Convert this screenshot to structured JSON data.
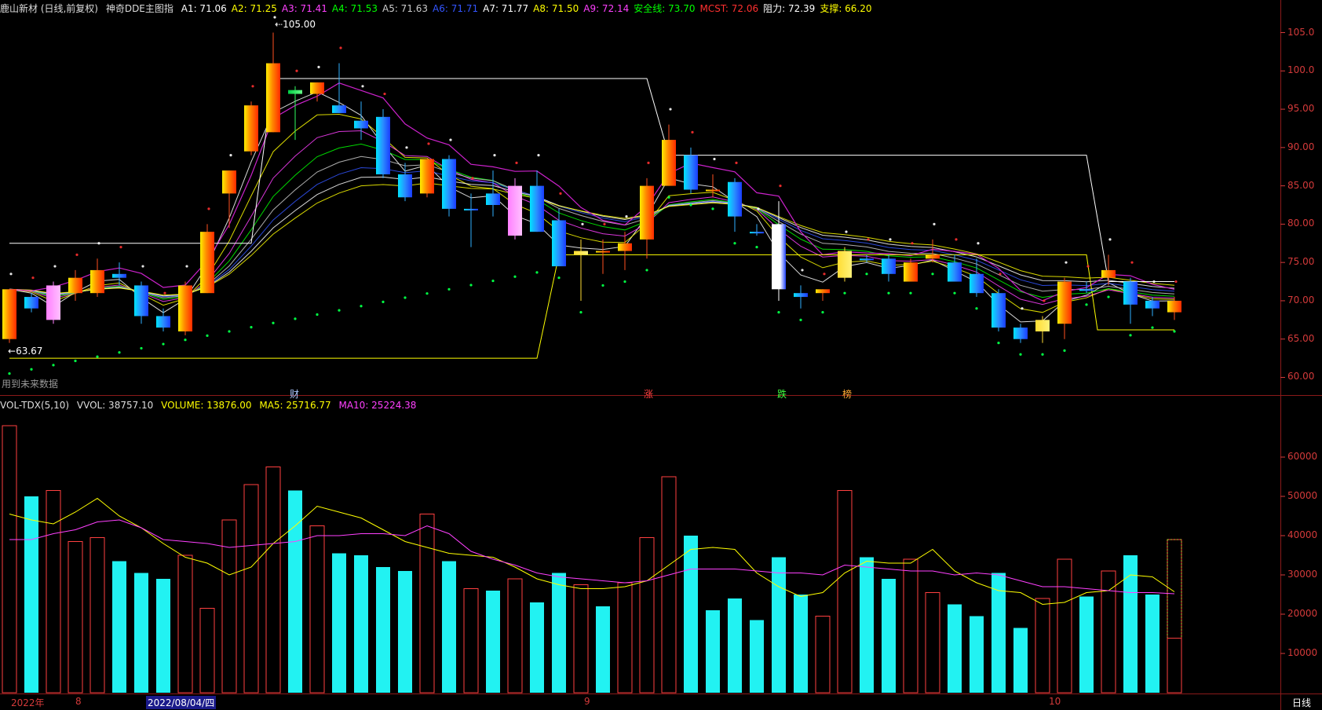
{
  "header": {
    "title": "鹿山新材 (日线,前复权)",
    "indicator": "神奇DDE主图指",
    "params": [
      {
        "label": "A1: 71.06",
        "color": "#ffffff"
      },
      {
        "label": "A2: 71.25",
        "color": "#ffff00"
      },
      {
        "label": "A3: 71.41",
        "color": "#ff40ff"
      },
      {
        "label": "A4: 71.53",
        "color": "#00ff00"
      },
      {
        "label": "A5: 71.63",
        "color": "#cccccc"
      },
      {
        "label": "A6: 71.71",
        "color": "#3355ff"
      },
      {
        "label": "A7: 71.77",
        "color": "#ffffff"
      },
      {
        "label": "A8: 71.50",
        "color": "#ffff00"
      },
      {
        "label": "A9: 72.14",
        "color": "#ff40ff"
      },
      {
        "label": "安全线: 73.70",
        "color": "#00ff00"
      },
      {
        "label": "MCST: 72.06",
        "color": "#ff3030"
      },
      {
        "label": "阻力: 72.39",
        "color": "#ffffff"
      },
      {
        "label": "支撑: 66.20",
        "color": "#ffff00"
      }
    ]
  },
  "volume_header": {
    "title": "VOL-TDX(5,10)",
    "vvol": "VVOL: 38757.10",
    "volume": "VOLUME: 13876.00",
    "ma5": "MA5: 25716.77",
    "ma10": "MA10: 25224.38"
  },
  "annotations": {
    "high": "105.00",
    "low": "63.67",
    "bottom_note": "用到未来数据",
    "events": [
      "财",
      "涨",
      "跌",
      "榜"
    ],
    "period": "日线"
  },
  "x_labels": [
    "2022年",
    "8",
    "2022/08/04/四",
    "9",
    "10"
  ],
  "colors": {
    "up": "#ff3030",
    "down": "#00e5ff",
    "axis": "#d43a3a",
    "grid": "#8b1a1a"
  },
  "chart_data": [
    {
      "type": "candlestick",
      "title": "",
      "ylim": [
        58,
        107
      ],
      "y_ticks": [
        60,
        65,
        70,
        75,
        80,
        85,
        90,
        95,
        100,
        105
      ],
      "y_tick_labels": [
        "60.00",
        "65.00",
        "70.00",
        "75.00",
        "80.00",
        "85.00",
        "90.00",
        "95.00",
        "100.0",
        "105.0"
      ],
      "candles": [
        {
          "o": 65,
          "h": 71.5,
          "l": 64.5,
          "c": 71.5,
          "col": "fire"
        },
        {
          "o": 69,
          "h": 71,
          "l": 68.5,
          "c": 70.5,
          "col": "blue"
        },
        {
          "o": 72,
          "h": 72.5,
          "l": 67,
          "c": 67.5,
          "col": "pink"
        },
        {
          "o": 71,
          "h": 74,
          "l": 70,
          "c": 73,
          "col": "fire"
        },
        {
          "o": 71,
          "h": 75.5,
          "l": 70.5,
          "c": 74,
          "col": "fire"
        },
        {
          "o": 73.5,
          "h": 75,
          "l": 72,
          "c": 73,
          "col": "blue"
        },
        {
          "o": 72,
          "h": 72.5,
          "l": 67,
          "c": 68,
          "col": "blue"
        },
        {
          "o": 68,
          "h": 69,
          "l": 66,
          "c": 66.5,
          "col": "blue"
        },
        {
          "o": 66,
          "h": 72.5,
          "l": 65.5,
          "c": 72,
          "col": "fire"
        },
        {
          "o": 71,
          "h": 80,
          "l": 71,
          "c": 79,
          "col": "fire"
        },
        {
          "o": 84,
          "h": 87,
          "l": 79.5,
          "c": 87,
          "col": "fire"
        },
        {
          "o": 89.5,
          "h": 96,
          "l": 89,
          "c": 95.5,
          "col": "fire"
        },
        {
          "o": 92,
          "h": 105,
          "l": 92,
          "c": 101,
          "col": "fire"
        },
        {
          "o": 97,
          "h": 98,
          "l": 91,
          "c": 97.5,
          "col": "green"
        },
        {
          "o": 97,
          "h": 98.5,
          "l": 96,
          "c": 98.5,
          "col": "fire"
        },
        {
          "o": 95.5,
          "h": 101,
          "l": 94.5,
          "c": 94.5,
          "col": "blue"
        },
        {
          "o": 93.5,
          "h": 96,
          "l": 91,
          "c": 92.5,
          "col": "blue"
        },
        {
          "o": 94,
          "h": 95,
          "l": 86,
          "c": 86.5,
          "col": "blue"
        },
        {
          "o": 86.5,
          "h": 88,
          "l": 83,
          "c": 83.5,
          "col": "blue"
        },
        {
          "o": 84,
          "h": 88.5,
          "l": 83.5,
          "c": 88.5,
          "col": "fire"
        },
        {
          "o": 88.5,
          "h": 89,
          "l": 81,
          "c": 82,
          "col": "blue"
        },
        {
          "o": 82,
          "h": 84,
          "l": 77,
          "c": 82,
          "col": "blue"
        },
        {
          "o": 82.5,
          "h": 87,
          "l": 81,
          "c": 84,
          "col": "blue"
        },
        {
          "o": 85,
          "h": 86,
          "l": 78,
          "c": 78.5,
          "col": "pink"
        },
        {
          "o": 85,
          "h": 87,
          "l": 79,
          "c": 79,
          "col": "blue"
        },
        {
          "o": 80.5,
          "h": 82,
          "l": 74.5,
          "c": 74.5,
          "col": "blue"
        },
        {
          "o": 76,
          "h": 78,
          "l": 70,
          "c": 76.5,
          "col": "gold"
        },
        {
          "o": 76.5,
          "h": 78,
          "l": 73.5,
          "c": 76.5,
          "col": "fire"
        },
        {
          "o": 76.5,
          "h": 79,
          "l": 74,
          "c": 77.5,
          "col": "fire"
        },
        {
          "o": 78,
          "h": 86,
          "l": 75.5,
          "c": 85,
          "col": "fire"
        },
        {
          "o": 85,
          "h": 93,
          "l": 85,
          "c": 91,
          "col": "fire"
        },
        {
          "o": 89,
          "h": 90,
          "l": 84,
          "c": 84.5,
          "col": "blue"
        },
        {
          "o": 84.5,
          "h": 86.5,
          "l": 83.5,
          "c": 84.5,
          "col": "fire"
        },
        {
          "o": 85.5,
          "h": 86,
          "l": 79,
          "c": 81,
          "col": "blue"
        },
        {
          "o": 79,
          "h": 80,
          "l": 78.5,
          "c": 79,
          "col": "blue"
        },
        {
          "o": 80,
          "h": 83,
          "l": 70,
          "c": 71.5,
          "col": "whiteblue"
        },
        {
          "o": 71,
          "h": 72,
          "l": 69,
          "c": 70.5,
          "col": "blue"
        },
        {
          "o": 71,
          "h": 71.5,
          "l": 70,
          "c": 71.5,
          "col": "fire"
        },
        {
          "o": 73,
          "h": 77,
          "l": 72.5,
          "c": 76.5,
          "col": "gold"
        },
        {
          "o": 75.5,
          "h": 76,
          "l": 75,
          "c": 75.5,
          "col": "blue"
        },
        {
          "o": 75.5,
          "h": 76,
          "l": 72.5,
          "c": 73.5,
          "col": "blue"
        },
        {
          "o": 72.5,
          "h": 75.5,
          "l": 72.5,
          "c": 75,
          "col": "fire"
        },
        {
          "o": 75.5,
          "h": 78,
          "l": 75,
          "c": 76,
          "col": "fire"
        },
        {
          "o": 75,
          "h": 76,
          "l": 72.5,
          "c": 72.5,
          "col": "blue"
        },
        {
          "o": 73.5,
          "h": 75.5,
          "l": 70.5,
          "c": 71,
          "col": "blue"
        },
        {
          "o": 71,
          "h": 71.5,
          "l": 66,
          "c": 66.5,
          "col": "blue"
        },
        {
          "o": 66.5,
          "h": 67,
          "l": 64.5,
          "c": 65,
          "col": "blue"
        },
        {
          "o": 66,
          "h": 68,
          "l": 64.5,
          "c": 67.5,
          "col": "gold"
        },
        {
          "o": 67,
          "h": 73,
          "l": 65,
          "c": 72.5,
          "col": "fire"
        },
        {
          "o": 71.5,
          "h": 72.5,
          "l": 71,
          "c": 71.5,
          "col": "blue"
        },
        {
          "o": 73,
          "h": 76,
          "l": 72,
          "c": 74,
          "col": "fire"
        },
        {
          "o": 72.5,
          "h": 73,
          "l": 67,
          "c": 69.5,
          "col": "blue"
        },
        {
          "o": 70,
          "h": 70.5,
          "l": 68,
          "c": 69,
          "col": "blue"
        },
        {
          "o": 68.5,
          "h": 70.5,
          "l": 67.5,
          "c": 70,
          "col": "fire"
        }
      ]
    },
    {
      "type": "bar",
      "title": "",
      "ylim": [
        0,
        72000
      ],
      "y_ticks": [
        10000,
        20000,
        30000,
        40000,
        50000,
        60000
      ],
      "y_tick_labels": [
        "10000",
        "20000",
        "30000",
        "40000",
        "50000",
        "60000"
      ],
      "volumes": [
        68000,
        50000,
        51500,
        38500,
        39500,
        33500,
        30500,
        29000,
        35000,
        21500,
        44000,
        53000,
        57500,
        51500,
        42500,
        35500,
        35000,
        32000,
        31000,
        45500,
        33500,
        26500,
        26000,
        29000,
        23000,
        30500,
        27500,
        22000,
        28000,
        39500,
        55000,
        40000,
        21000,
        24000,
        18500,
        34500,
        25000,
        19500,
        51500,
        34500,
        29000,
        34000,
        25500,
        22500,
        19500,
        30500,
        16500,
        24000,
        34000,
        24500,
        31000,
        35000,
        25000,
        39000
      ],
      "vol_up": [
        true,
        false,
        true,
        true,
        true,
        false,
        false,
        false,
        true,
        true,
        true,
        true,
        true,
        false,
        true,
        false,
        false,
        false,
        false,
        true,
        false,
        true,
        false,
        true,
        false,
        false,
        true,
        false,
        true,
        true,
        true,
        false,
        false,
        false,
        false,
        false,
        false,
        true,
        true,
        false,
        false,
        true,
        true,
        false,
        false,
        false,
        false,
        true,
        true,
        false,
        true,
        false,
        false,
        true
      ],
      "series": [
        {
          "name": "MA5",
          "values": [
            45500,
            44000,
            43000,
            46000,
            49500,
            45000,
            42000,
            38000,
            34500,
            33000,
            30000,
            32000,
            38000,
            42500,
            47500,
            46000,
            44500,
            41500,
            38500,
            37000,
            35500,
            35000,
            34500,
            32000,
            29000,
            27500,
            26500,
            26500,
            27000,
            28500,
            32500,
            36500,
            37000,
            36500,
            30500,
            27000,
            24500,
            25500,
            30500,
            33500,
            33000,
            33000,
            36500,
            31000,
            28000,
            26000,
            25500,
            22500,
            23000,
            25500,
            26000,
            30000,
            29500,
            25700
          ]
        },
        {
          "name": "MA10",
          "values": [
            39000,
            39000,
            40500,
            41500,
            43500,
            44000,
            42000,
            39000,
            38500,
            38000,
            37000,
            37500,
            38000,
            38500,
            40000,
            40000,
            40500,
            40500,
            40000,
            42500,
            40500,
            36000,
            34000,
            32500,
            30500,
            29500,
            29000,
            28500,
            28000,
            28500,
            30000,
            31500,
            31500,
            31500,
            31000,
            30500,
            30500,
            30000,
            32500,
            32000,
            31500,
            31000,
            31000,
            30000,
            30500,
            30000,
            28500,
            27000,
            27000,
            26500,
            26000,
            25500,
            25500,
            25200
          ]
        }
      ]
    }
  ]
}
